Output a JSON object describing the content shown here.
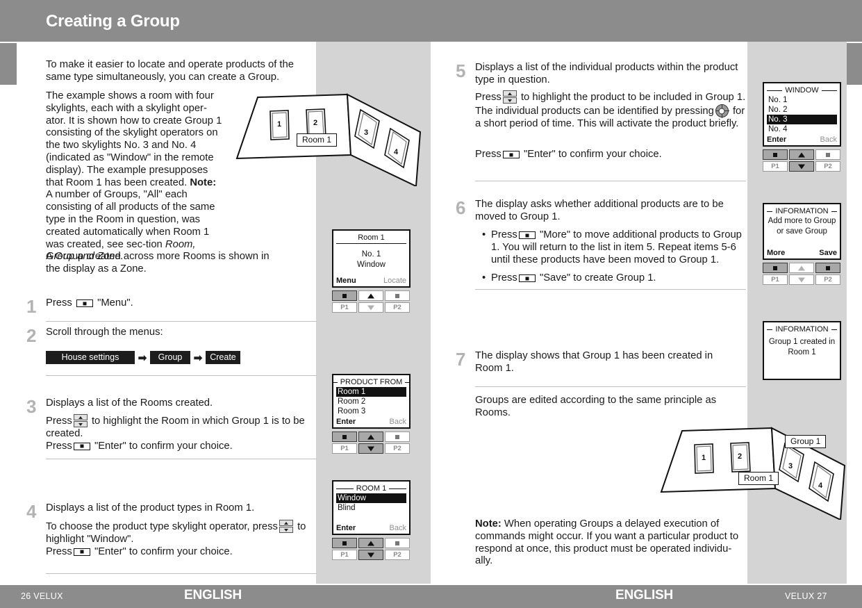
{
  "header": {
    "title": "Creating a Group"
  },
  "footer": {
    "left_page": "26  VELUX",
    "right_page": "VELUX  27",
    "language_left": "ENGLISH",
    "language_right": "ENGLISH"
  },
  "intro": {
    "p1": "To make it easier to locate and operate products of the same type simultaneously, you can create a Group.",
    "p2_a": "The example shows a room with four skylights, each with a skylight oper-ator. It is shown how to create Group 1 consisting of the skylight operators on the two skylights No. 3 and No. 4 (indicated as \"Window\" in the remote display). The example presupposes that Room 1 has been created.",
    "p2_note_label": "Note:",
    "p2_note_body": " A number of Groups, \"All\" each consisting of all products of the same type in the Room in question, was created automatically when Room 1 was created, see sec-tion ",
    "p2_note_italic": "Room, Group and Zone.",
    "p3": "A Group created across more Rooms is shown in the display as a Zone."
  },
  "steps": {
    "s1": {
      "num": "1",
      "press_label": "Press",
      "quoted": "\"Menu\"."
    },
    "s2": {
      "num": "2",
      "title": "Scroll through the menus:",
      "path": [
        "House settings",
        "Group",
        "Create"
      ],
      "arrow": "➡"
    },
    "s3": {
      "num": "3",
      "line1": "Displays a list of the Rooms created.",
      "line2_a": "Press",
      "line2_b": " to highlight the Room in which Group 1 is to be created.",
      "line3_a": "Press",
      "line3_b": " \"Enter\" to confirm your choice."
    },
    "s4": {
      "num": "4",
      "line1": "Displays a list of the product types in Room 1.",
      "line2_a": "To choose the product type skylight operator, press",
      "line2_b": " to highlight \"Window\".",
      "line3_a": "Press",
      "line3_b": " \"Enter\" to confirm your choice."
    },
    "s5": {
      "num": "5",
      "line1": "Displays a list of the individual products within the product type in question.",
      "line2_a": "Press",
      "line2_b": " to highlight the product to be included in Group 1. The individual products can be identified by pressing",
      "line2_c": " for a short period of time. This will activate the product briefly.",
      "line3_a": "Press",
      "line3_b": " \"Enter\" to confirm your choice."
    },
    "s6": {
      "num": "6",
      "line1": "The display asks whether additional products are to be moved to Group 1.",
      "bullet1_a": "Press",
      "bullet1_b": " \"More\" to move additional products to Group 1. You will return to the list in item 5. Repeat items 5-6 until these products have been moved to Group 1.",
      "bullet2_a": "Press",
      "bullet2_b": " \"Save\" to create Group 1.",
      "bullet_char": "•"
    },
    "s7": {
      "num": "7",
      "line1": "The display shows that Group 1 has been created in Room 1."
    }
  },
  "closing": {
    "p1": "Groups are edited according to the same principle as Rooms.",
    "note_label": "Note:",
    "note_body": " When operating Groups a delayed execution of commands might occur. If you want a particular product to respond at once, this product must be operated individu-ally."
  },
  "remotes": {
    "r1": {
      "title": "Room 1",
      "title_style": "plain",
      "center_lines": [
        "No. 1",
        "Window"
      ],
      "footer_left": "Menu",
      "footer_right": "Locate",
      "buttons_top": [
        "select-active",
        "up-inactive",
        "square-inactive"
      ],
      "buttons_bottom": [
        "P1",
        "down-inactive",
        "P2"
      ]
    },
    "r2": {
      "title": "PRODUCT FROM",
      "items": [
        "Room 1",
        "Room 2",
        "Room 3"
      ],
      "selected_index": 0,
      "footer_left": "Enter",
      "footer_right": "Back",
      "buttons_bottom": [
        "P1",
        "down-active",
        "P2"
      ]
    },
    "r3": {
      "title": "ROOM 1",
      "items": [
        "Window",
        "Blind"
      ],
      "selected_index": 0,
      "footer_left": "Enter",
      "footer_right": "Back",
      "buttons_bottom": [
        "P1",
        "down-active",
        "P2"
      ]
    },
    "r4": {
      "title": "WINDOW",
      "items": [
        "No. 1",
        "No. 2",
        "No. 3",
        "No. 4"
      ],
      "selected_index": 2,
      "footer_left": "Enter",
      "footer_right": "Back",
      "buttons_bottom": [
        "P1",
        "down-active",
        "P2"
      ]
    },
    "r5": {
      "title": "INFORMATION",
      "center_lines": [
        "Add more to Group",
        "or save Group"
      ],
      "footer_left": "More",
      "footer_right": "Save",
      "buttons_bottom": [
        "P1",
        "down-inactive",
        "P2"
      ]
    },
    "r6": {
      "title": "INFORMATION",
      "center_lines": [
        "Group 1 created in",
        "Room 1"
      ]
    }
  },
  "illustrations": {
    "top": {
      "room_tag": "Room 1",
      "window_numbers": [
        "1",
        "2",
        "3",
        "4"
      ]
    },
    "bottom": {
      "room_tag": "Room 1",
      "group_tag": "Group 1",
      "window_numbers": [
        "1",
        "2",
        "3",
        "4"
      ]
    }
  },
  "buttons": {
    "p1": "P1",
    "p2": "P2"
  }
}
